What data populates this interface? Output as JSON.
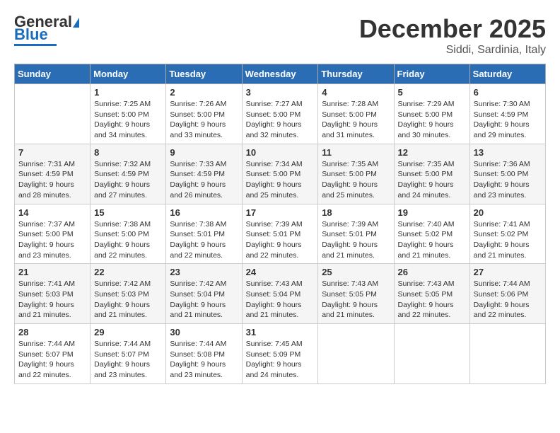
{
  "header": {
    "logo_line1": "General",
    "logo_line2": "Blue",
    "month": "December 2025",
    "location": "Siddi, Sardinia, Italy"
  },
  "weekdays": [
    "Sunday",
    "Monday",
    "Tuesday",
    "Wednesday",
    "Thursday",
    "Friday",
    "Saturday"
  ],
  "weeks": [
    [
      {
        "day": "",
        "info": ""
      },
      {
        "day": "1",
        "info": "Sunrise: 7:25 AM\nSunset: 5:00 PM\nDaylight: 9 hours\nand 34 minutes."
      },
      {
        "day": "2",
        "info": "Sunrise: 7:26 AM\nSunset: 5:00 PM\nDaylight: 9 hours\nand 33 minutes."
      },
      {
        "day": "3",
        "info": "Sunrise: 7:27 AM\nSunset: 5:00 PM\nDaylight: 9 hours\nand 32 minutes."
      },
      {
        "day": "4",
        "info": "Sunrise: 7:28 AM\nSunset: 5:00 PM\nDaylight: 9 hours\nand 31 minutes."
      },
      {
        "day": "5",
        "info": "Sunrise: 7:29 AM\nSunset: 5:00 PM\nDaylight: 9 hours\nand 30 minutes."
      },
      {
        "day": "6",
        "info": "Sunrise: 7:30 AM\nSunset: 4:59 PM\nDaylight: 9 hours\nand 29 minutes."
      }
    ],
    [
      {
        "day": "7",
        "info": "Sunrise: 7:31 AM\nSunset: 4:59 PM\nDaylight: 9 hours\nand 28 minutes."
      },
      {
        "day": "8",
        "info": "Sunrise: 7:32 AM\nSunset: 4:59 PM\nDaylight: 9 hours\nand 27 minutes."
      },
      {
        "day": "9",
        "info": "Sunrise: 7:33 AM\nSunset: 4:59 PM\nDaylight: 9 hours\nand 26 minutes."
      },
      {
        "day": "10",
        "info": "Sunrise: 7:34 AM\nSunset: 5:00 PM\nDaylight: 9 hours\nand 25 minutes."
      },
      {
        "day": "11",
        "info": "Sunrise: 7:35 AM\nSunset: 5:00 PM\nDaylight: 9 hours\nand 25 minutes."
      },
      {
        "day": "12",
        "info": "Sunrise: 7:35 AM\nSunset: 5:00 PM\nDaylight: 9 hours\nand 24 minutes."
      },
      {
        "day": "13",
        "info": "Sunrise: 7:36 AM\nSunset: 5:00 PM\nDaylight: 9 hours\nand 23 minutes."
      }
    ],
    [
      {
        "day": "14",
        "info": "Sunrise: 7:37 AM\nSunset: 5:00 PM\nDaylight: 9 hours\nand 23 minutes."
      },
      {
        "day": "15",
        "info": "Sunrise: 7:38 AM\nSunset: 5:00 PM\nDaylight: 9 hours\nand 22 minutes."
      },
      {
        "day": "16",
        "info": "Sunrise: 7:38 AM\nSunset: 5:01 PM\nDaylight: 9 hours\nand 22 minutes."
      },
      {
        "day": "17",
        "info": "Sunrise: 7:39 AM\nSunset: 5:01 PM\nDaylight: 9 hours\nand 22 minutes."
      },
      {
        "day": "18",
        "info": "Sunrise: 7:39 AM\nSunset: 5:01 PM\nDaylight: 9 hours\nand 21 minutes."
      },
      {
        "day": "19",
        "info": "Sunrise: 7:40 AM\nSunset: 5:02 PM\nDaylight: 9 hours\nand 21 minutes."
      },
      {
        "day": "20",
        "info": "Sunrise: 7:41 AM\nSunset: 5:02 PM\nDaylight: 9 hours\nand 21 minutes."
      }
    ],
    [
      {
        "day": "21",
        "info": "Sunrise: 7:41 AM\nSunset: 5:03 PM\nDaylight: 9 hours\nand 21 minutes."
      },
      {
        "day": "22",
        "info": "Sunrise: 7:42 AM\nSunset: 5:03 PM\nDaylight: 9 hours\nand 21 minutes."
      },
      {
        "day": "23",
        "info": "Sunrise: 7:42 AM\nSunset: 5:04 PM\nDaylight: 9 hours\nand 21 minutes."
      },
      {
        "day": "24",
        "info": "Sunrise: 7:43 AM\nSunset: 5:04 PM\nDaylight: 9 hours\nand 21 minutes."
      },
      {
        "day": "25",
        "info": "Sunrise: 7:43 AM\nSunset: 5:05 PM\nDaylight: 9 hours\nand 21 minutes."
      },
      {
        "day": "26",
        "info": "Sunrise: 7:43 AM\nSunset: 5:05 PM\nDaylight: 9 hours\nand 22 minutes."
      },
      {
        "day": "27",
        "info": "Sunrise: 7:44 AM\nSunset: 5:06 PM\nDaylight: 9 hours\nand 22 minutes."
      }
    ],
    [
      {
        "day": "28",
        "info": "Sunrise: 7:44 AM\nSunset: 5:07 PM\nDaylight: 9 hours\nand 22 minutes."
      },
      {
        "day": "29",
        "info": "Sunrise: 7:44 AM\nSunset: 5:07 PM\nDaylight: 9 hours\nand 23 minutes."
      },
      {
        "day": "30",
        "info": "Sunrise: 7:44 AM\nSunset: 5:08 PM\nDaylight: 9 hours\nand 23 minutes."
      },
      {
        "day": "31",
        "info": "Sunrise: 7:45 AM\nSunset: 5:09 PM\nDaylight: 9 hours\nand 24 minutes."
      },
      {
        "day": "",
        "info": ""
      },
      {
        "day": "",
        "info": ""
      },
      {
        "day": "",
        "info": ""
      }
    ]
  ]
}
